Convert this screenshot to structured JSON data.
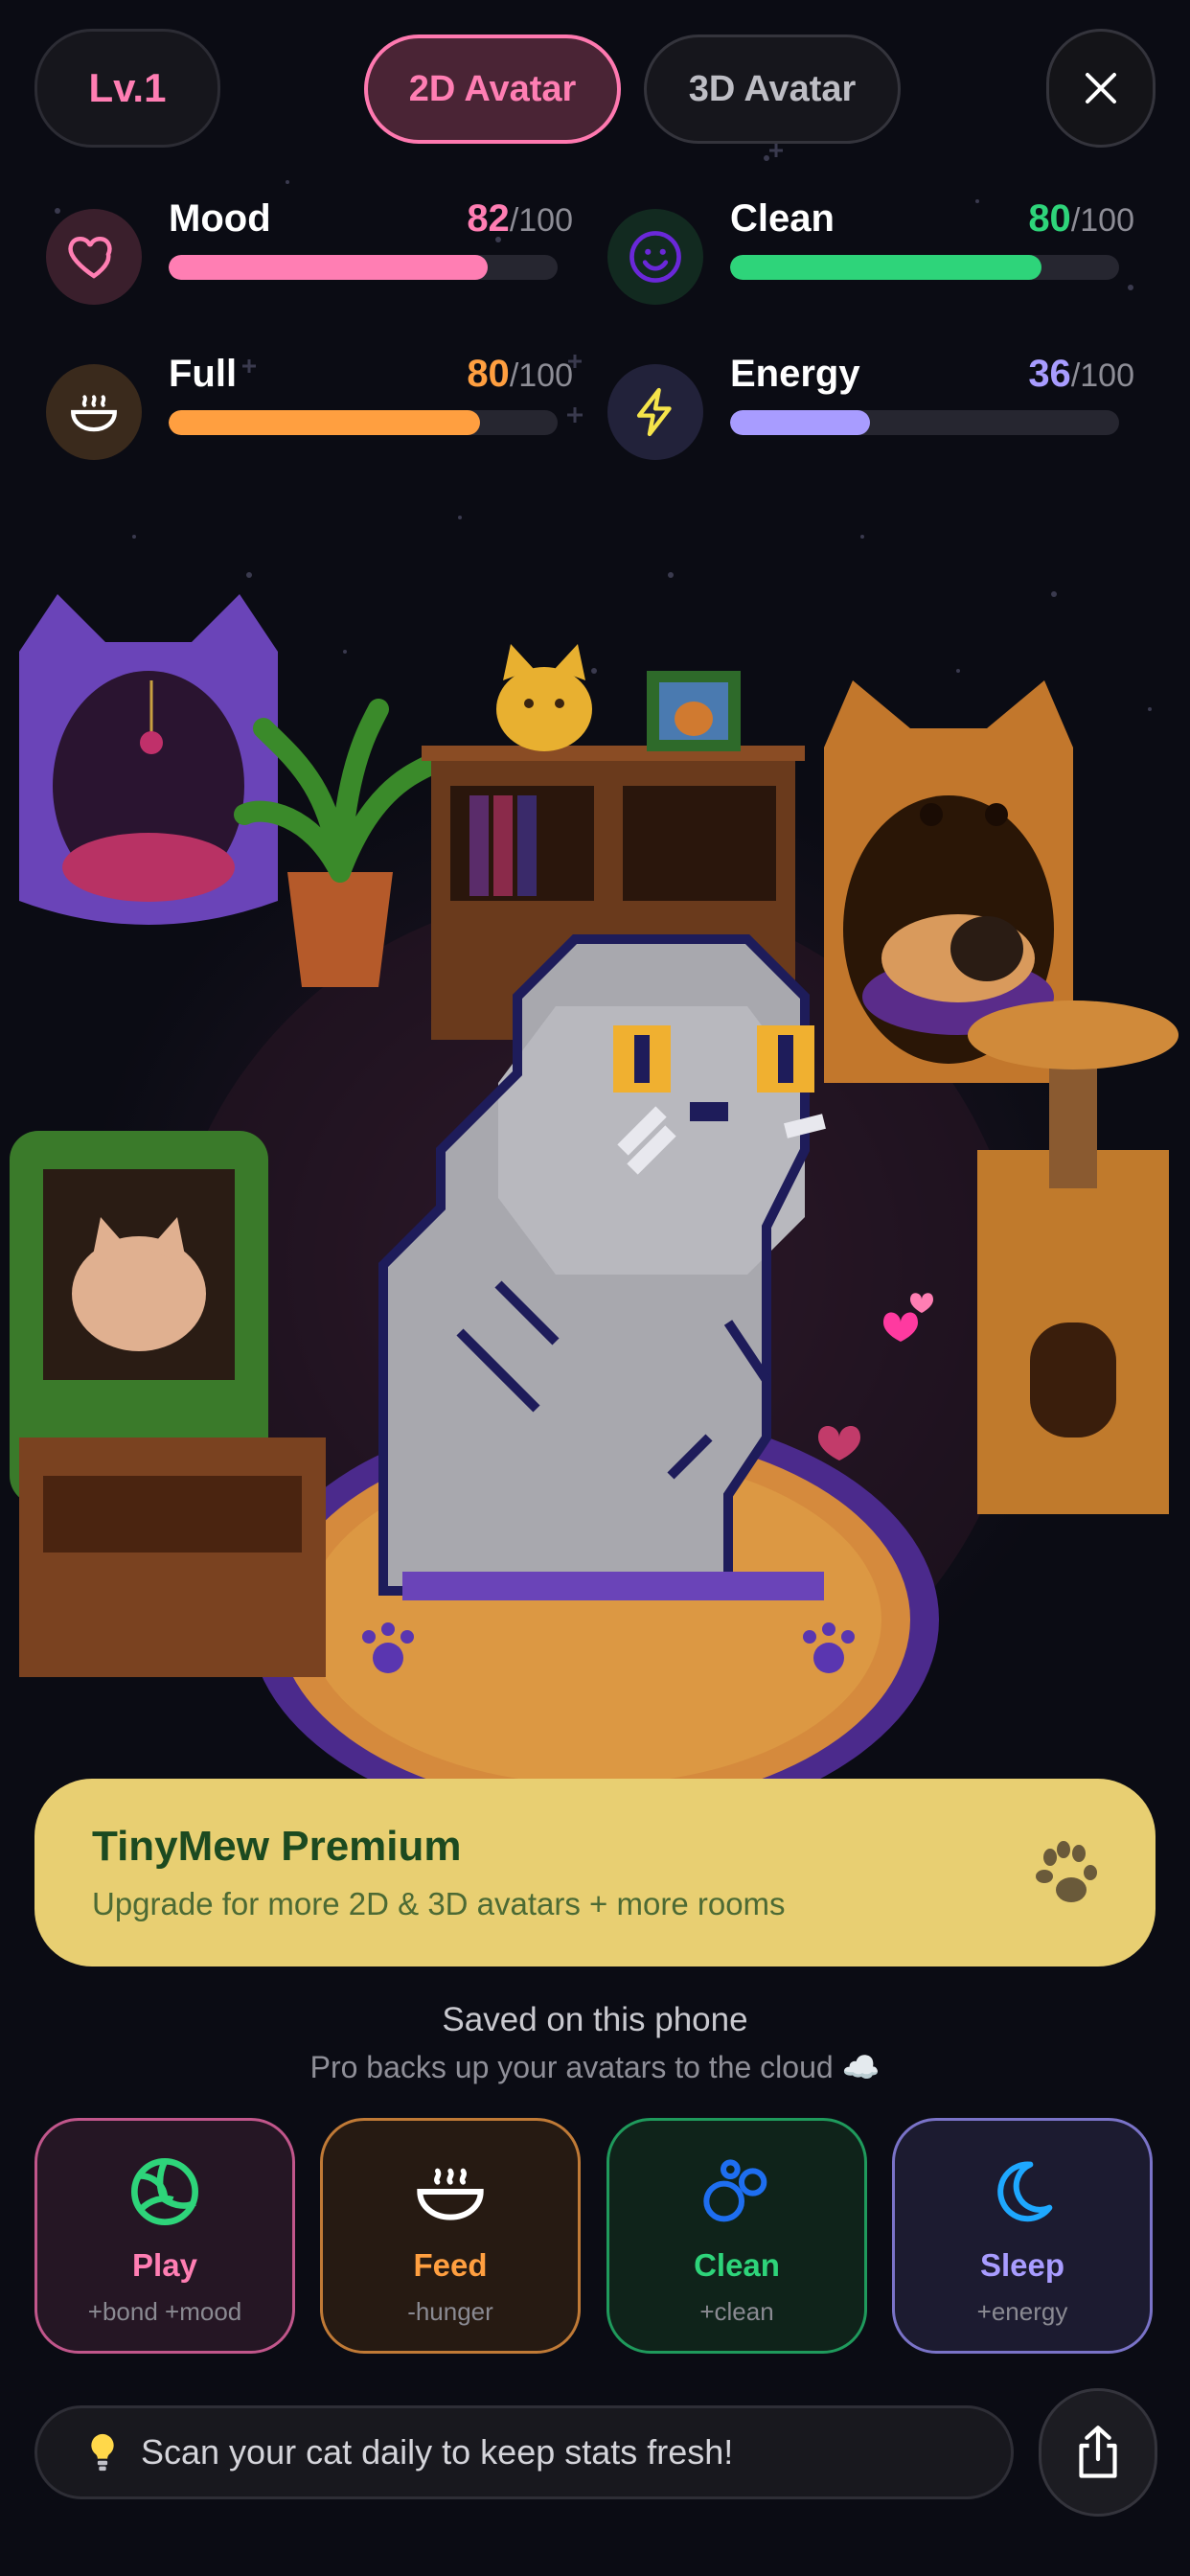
{
  "header": {
    "level": "Lv.1",
    "tab_2d": "2D Avatar",
    "tab_3d": "3D Avatar",
    "close_icon": "close-icon"
  },
  "stats": {
    "mood": {
      "label": "Mood",
      "value": "82",
      "max": "/100",
      "fraction": 0.82,
      "color": "#ff7eb3",
      "icon": "heart-icon"
    },
    "clean": {
      "label": "Clean",
      "value": "80",
      "max": "/100",
      "fraction": 0.8,
      "color": "#2ed47a",
      "icon": "smiley-icon"
    },
    "full": {
      "label": "Full",
      "value": "80",
      "max": "/100",
      "fraction": 0.8,
      "color": "#ff9f40",
      "icon": "bowl-icon"
    },
    "energy": {
      "label": "Energy",
      "value": "36",
      "max": "/100",
      "fraction": 0.36,
      "color": "#a89cff",
      "icon": "lightning-icon"
    }
  },
  "premium": {
    "title": "TinyMew Premium",
    "subtitle": "Upgrade for more 2D & 3D avatars + more rooms",
    "icon": "paw-icon"
  },
  "storage": {
    "line1": "Saved on this phone",
    "line2": "Pro backs up your avatars to the cloud ☁️"
  },
  "actions": [
    {
      "label": "Play",
      "sub": "+bond +mood",
      "color": "#ff7eb3",
      "icon": "ball-icon"
    },
    {
      "label": "Feed",
      "sub": "-hunger",
      "color": "#ff9f40",
      "icon": "bowl-icon"
    },
    {
      "label": "Clean",
      "sub": "+clean",
      "color": "#2ed47a",
      "icon": "bubbles-icon"
    },
    {
      "label": "Sleep",
      "sub": "+energy",
      "color": "#a89cff",
      "icon": "moon-icon"
    }
  ],
  "tip": {
    "text": "Scan your cat daily to keep stats fresh!",
    "icon": "lightbulb-icon"
  },
  "share_icon": "share-icon",
  "colors": {
    "background": "#0b0c14",
    "accent_pink": "#ff7eb3",
    "premium_bg": "#e8cf72"
  }
}
